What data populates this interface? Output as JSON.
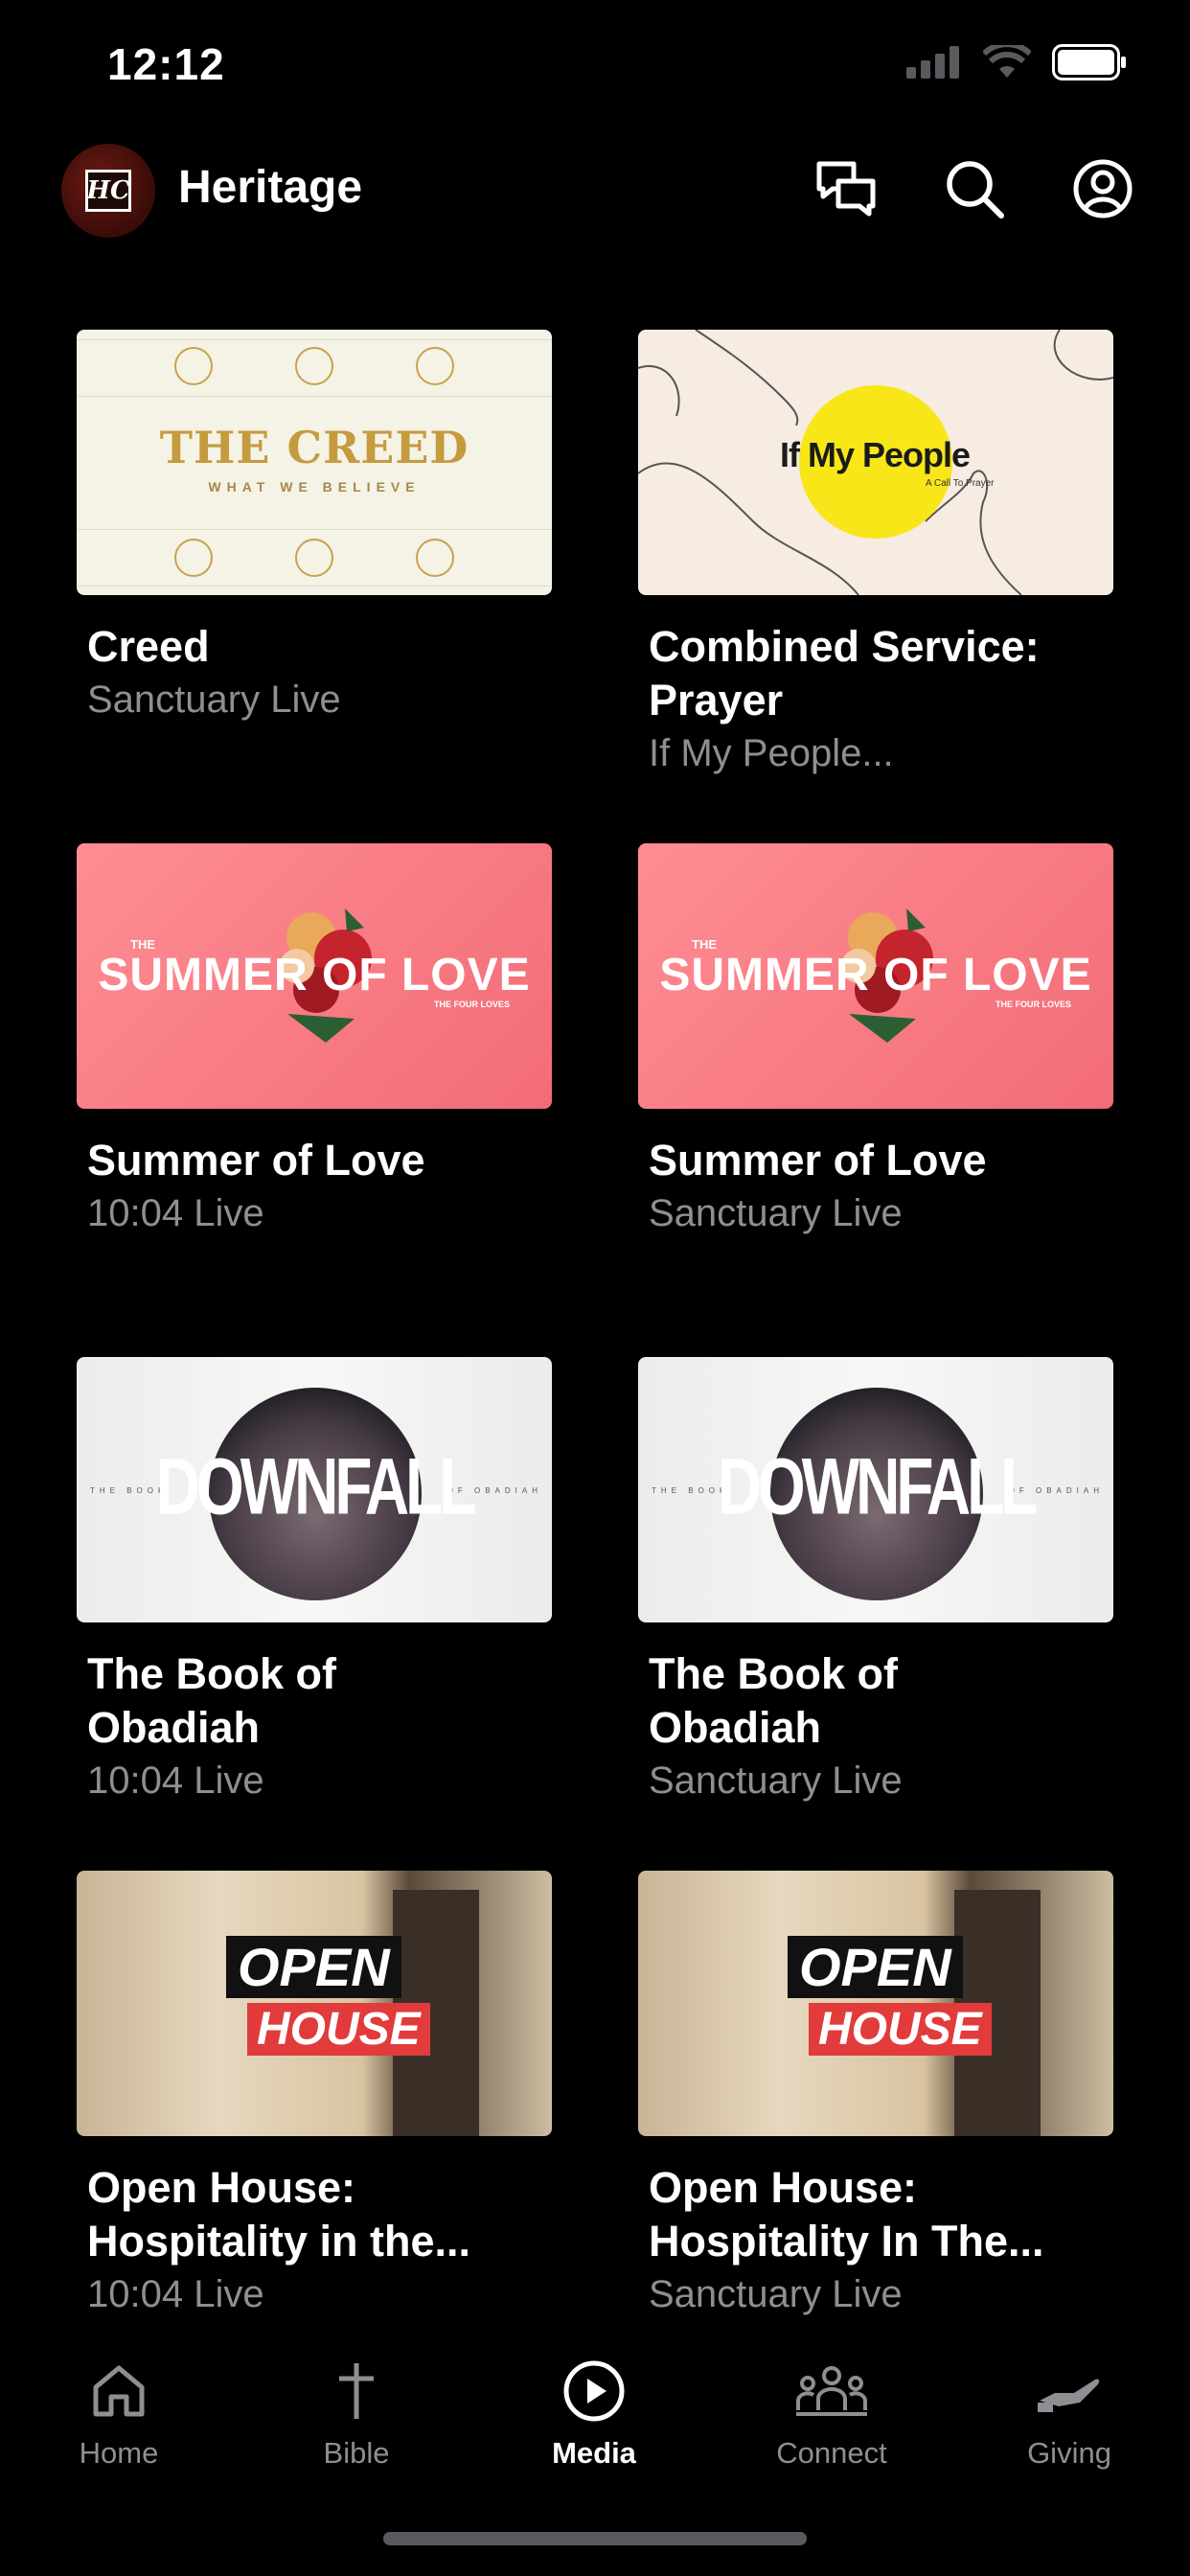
{
  "status_bar": {
    "time": "12:12"
  },
  "header": {
    "title": "Heritage",
    "logo_text": "HC"
  },
  "cards": [
    {
      "title": "Creed",
      "subtitle": "Sanctuary Live",
      "thumb": {
        "headline": "THE CREED",
        "tagline": "WHAT WE BELIEVE"
      }
    },
    {
      "title": "Combined Service: Prayer",
      "subtitle": "If My People...",
      "thumb": {
        "headline": "If My People",
        "tagline": "A Call To Prayer"
      }
    },
    {
      "title": "Summer of Love",
      "subtitle": "10:04 Live",
      "thumb": {
        "pre": "THE",
        "headline": "SUMMER OF LOVE",
        "tagline": "THE FOUR LOVES"
      }
    },
    {
      "title": "Summer of Love",
      "subtitle": "Sanctuary Live",
      "thumb": {
        "pre": "THE",
        "headline": "SUMMER OF LOVE",
        "tagline": "THE FOUR LOVES"
      }
    },
    {
      "title": "The Book of Obadiah",
      "subtitle": "10:04 Live",
      "thumb": {
        "headline": "DOWNFALL",
        "left": "THE BOOK",
        "right": "OF OBADIAH"
      }
    },
    {
      "title": "The Book of Obadiah",
      "subtitle": "Sanctuary Live",
      "thumb": {
        "headline": "DOWNFALL",
        "left": "THE BOOK",
        "right": "OF OBADIAH"
      }
    },
    {
      "title": "Open House: Hospitality in the...",
      "subtitle": "10:04 Live",
      "thumb": {
        "headline": "OPEN",
        "headline2": "HOUSE"
      }
    },
    {
      "title": "Open House: Hospitality In The...",
      "subtitle": "Sanctuary Live",
      "thumb": {
        "headline": "OPEN",
        "headline2": "HOUSE"
      }
    }
  ],
  "tabs": [
    {
      "label": "Home",
      "icon": "home-icon",
      "active": false
    },
    {
      "label": "Bible",
      "icon": "cross-icon",
      "active": false
    },
    {
      "label": "Media",
      "icon": "play-icon",
      "active": true
    },
    {
      "label": "Connect",
      "icon": "people-icon",
      "active": false
    },
    {
      "label": "Giving",
      "icon": "giving-hand-icon",
      "active": false
    }
  ]
}
